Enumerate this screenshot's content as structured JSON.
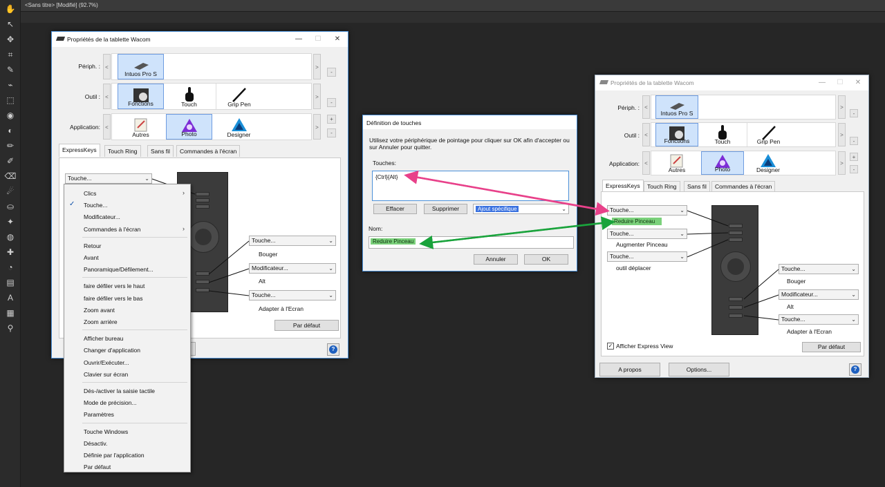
{
  "app": {
    "doc_tab": "<Sans titre> [Modifié] (92.7%)",
    "tools": [
      "hand-icon",
      "pointer-icon",
      "move-icon",
      "crop-icon",
      "paint-brush-icon",
      "selection-brush-icon",
      "marquee-icon",
      "fill-icon",
      "color-picker-icon",
      "brush-icon",
      "pencil-icon",
      "eraser-icon",
      "smudge-icon",
      "stamp-icon",
      "retouch-icon",
      "blur-icon",
      "healing-icon",
      "dodge-icon",
      "gradient-icon",
      "text-icon",
      "mesh-icon",
      "zoom-icon"
    ]
  },
  "left_window": {
    "title": "Propriétés de la tablette Wacom",
    "periph_label": "Périph. :",
    "outil_label": "Outil :",
    "application_label": "Application:",
    "periph_card": "Intuos Pro S",
    "outil_cards": [
      "Fonctions",
      "Touch",
      "Grip Pen"
    ],
    "app_cards": [
      "Autres",
      "Photo",
      "Designer"
    ],
    "tabs": [
      "ExpressKeys",
      "Touch Ring",
      "Sans fil",
      "Commandes à l'écran"
    ],
    "combo_top": "Touche...",
    "key_rows": [
      {
        "combo": "Touche...",
        "sub": "Bouger"
      },
      {
        "combo": "Modificateur...",
        "sub": "Alt"
      },
      {
        "combo": "Touche...",
        "sub": "Adapter à l'Ecran"
      }
    ],
    "default_button": "Par défaut",
    "help": "?"
  },
  "context_menu": {
    "groups": [
      [
        {
          "label": "Clics",
          "submenu": true
        },
        {
          "label": "Touche...",
          "checked": true
        },
        {
          "label": "Modificateur..."
        },
        {
          "label": "Commandes à l'écran",
          "submenu": true
        }
      ],
      [
        {
          "label": "Retour"
        },
        {
          "label": "Avant"
        },
        {
          "label": "Panoramique/Défilement..."
        }
      ],
      [
        {
          "label": "faire défiler vers le haut"
        },
        {
          "label": "faire défiler vers le bas"
        },
        {
          "label": "Zoom avant"
        },
        {
          "label": "Zoom arrière"
        }
      ],
      [
        {
          "label": "Afficher bureau"
        },
        {
          "label": "Changer d'application"
        },
        {
          "label": "Ouvrir/Exécuter..."
        },
        {
          "label": "Clavier sur écran"
        }
      ],
      [
        {
          "label": "Dés-/activer la saisie tactile"
        },
        {
          "label": "Mode de précision..."
        },
        {
          "label": "Paramètres"
        }
      ],
      [
        {
          "label": "Touche Windows"
        },
        {
          "label": "Désactiv."
        },
        {
          "label": "Définie par l'application"
        },
        {
          "label": "Par défaut"
        }
      ]
    ]
  },
  "touch_dialog": {
    "title": "Définition de touches",
    "instructions": "Utilisez votre périphérique de pointage pour cliquer sur OK afin d'accepter ou sur Annuler pour quitter.",
    "keys_label": "Touches:",
    "keys_value": "{Ctrl}{Alt}",
    "btn_clear": "Effacer",
    "btn_delete": "Supprimer",
    "special_combo": "Ajout spécifique",
    "name_label": "Nom:",
    "name_value": "Reduire Pinceau",
    "btn_cancel": "Annuler",
    "btn_ok": "OK"
  },
  "right_window": {
    "title": "Propriétés de la tablette Wacom",
    "periph_label": "Périph. :",
    "outil_label": "Outil :",
    "application_label": "Application:",
    "periph_card": "Intuos Pro S",
    "outil_cards": [
      "Fonctions",
      "Touch",
      "Grip Pen"
    ],
    "app_cards": [
      "Autres",
      "Photo",
      "Designer"
    ],
    "tabs": [
      "ExpressKeys",
      "Touch Ring",
      "Sans fil",
      "Commandes à l'écran"
    ],
    "left_keys": [
      {
        "combo": "Touche...",
        "sub": "Reduire Pinceau"
      },
      {
        "combo": "Touche...",
        "sub": "Augmenter Pinceau"
      },
      {
        "combo": "Touche...",
        "sub": "outil déplacer"
      }
    ],
    "right_keys": [
      {
        "combo": "Touche...",
        "sub": "Bouger"
      },
      {
        "combo": "Modificateur...",
        "sub": "Alt"
      },
      {
        "combo": "Touche...",
        "sub": "Adapter à l'Ecran"
      }
    ],
    "express_view": "Afficher Express View",
    "express_view_checked": true,
    "default_button": "Par défaut",
    "about_button": "A propos",
    "options_button": "Options...",
    "help": "?"
  },
  "colors": {
    "pink_arrow": "#e8418a",
    "green_arrow": "#1aa33c",
    "selection_blue": "#cfe3fb",
    "highlight_green": "#7bd17b",
    "highlight_blue": "#3c73e0"
  }
}
